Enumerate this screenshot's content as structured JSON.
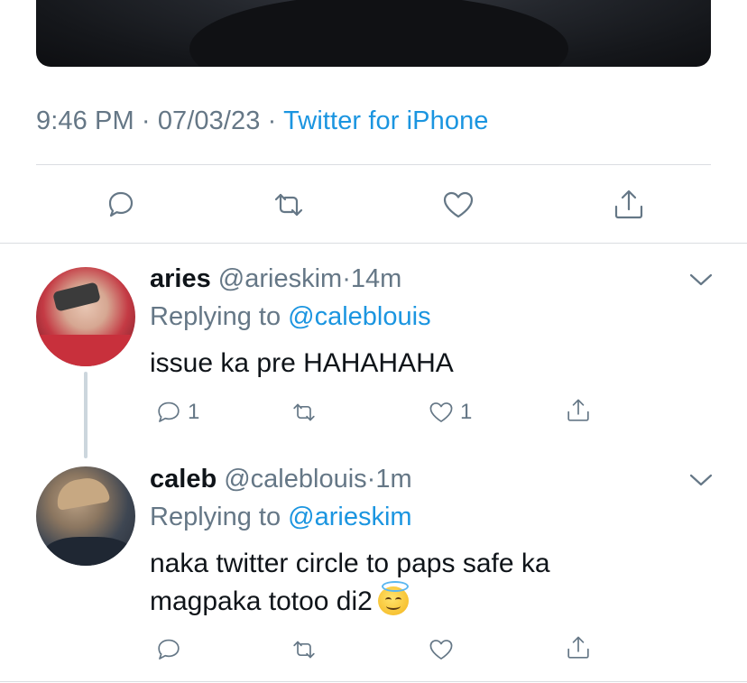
{
  "tweet": {
    "time": "9:46 PM",
    "separator": "·",
    "date": "07/03/23",
    "source": "Twitter for iPhone",
    "actions": {
      "reply_icon": "comment-icon",
      "retweet_icon": "retweet-icon",
      "like_icon": "heart-icon",
      "share_icon": "share-icon"
    }
  },
  "replies": [
    {
      "display_name": "aries",
      "handle": "@arieskim",
      "dot": "·",
      "age": "14m",
      "replying_prefix": "Replying to",
      "replying_to": "@caleblouis",
      "text": "issue ka pre HAHAHAHA",
      "reply_count": "1",
      "like_count": "1"
    },
    {
      "display_name": "caleb",
      "handle": "@caleblouis",
      "dot": "·",
      "age": "1m",
      "replying_prefix": "Replying to",
      "replying_to": "@arieskim",
      "text_line1": "naka twitter circle to paps safe ka",
      "text_line2": "magpaka totoo di2",
      "emoji": "smiling-face-with-halo"
    }
  ],
  "colors": {
    "accent": "#1b95e0",
    "secondary_text": "#657786",
    "primary_text": "#0f1419",
    "divider": "#dadde1"
  }
}
